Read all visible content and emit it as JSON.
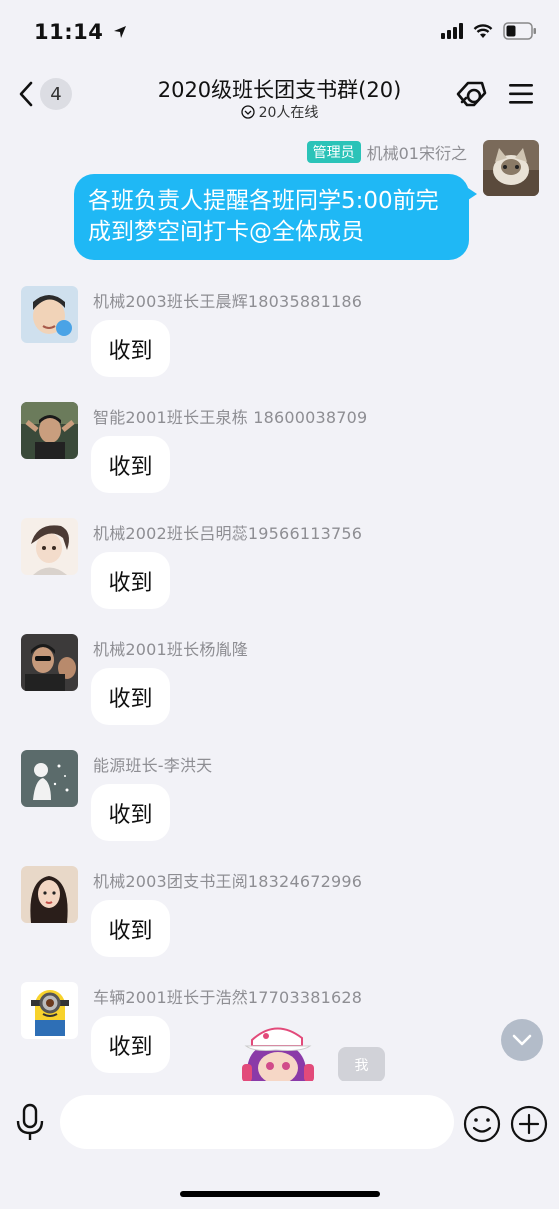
{
  "status": {
    "time": "11:14"
  },
  "nav": {
    "unread_count": "4",
    "title": "2020级班长团支书群(20)",
    "online": "20人在线"
  },
  "my_message": {
    "role_badge": "管理员",
    "sender": "机械01宋衍之",
    "text": "各班负责人提醒各班同学5:00前完成到梦空间打卡@全体成员"
  },
  "messages": [
    {
      "name": "机械2003班长王晨辉18035881186",
      "text": "收到"
    },
    {
      "name": "智能2001班长王泉栋 18600038709",
      "text": "收到"
    },
    {
      "name": "机械2002班长吕明蕊19566113756",
      "text": "收到"
    },
    {
      "name": "机械2001班长杨胤隆",
      "text": "收到"
    },
    {
      "name": "能源班长-李洪天",
      "text": "收到"
    },
    {
      "name": "机械2003团支书王阅18324672996",
      "text": "收到"
    },
    {
      "name": "车辆2001班长于浩然17703381628",
      "text": "收到"
    }
  ],
  "sticker_tag": "我",
  "input": {
    "placeholder": ""
  },
  "colors": {
    "accent": "#1fb8f5",
    "badge": "#2bc3b8",
    "background": "#f2f2f7"
  }
}
